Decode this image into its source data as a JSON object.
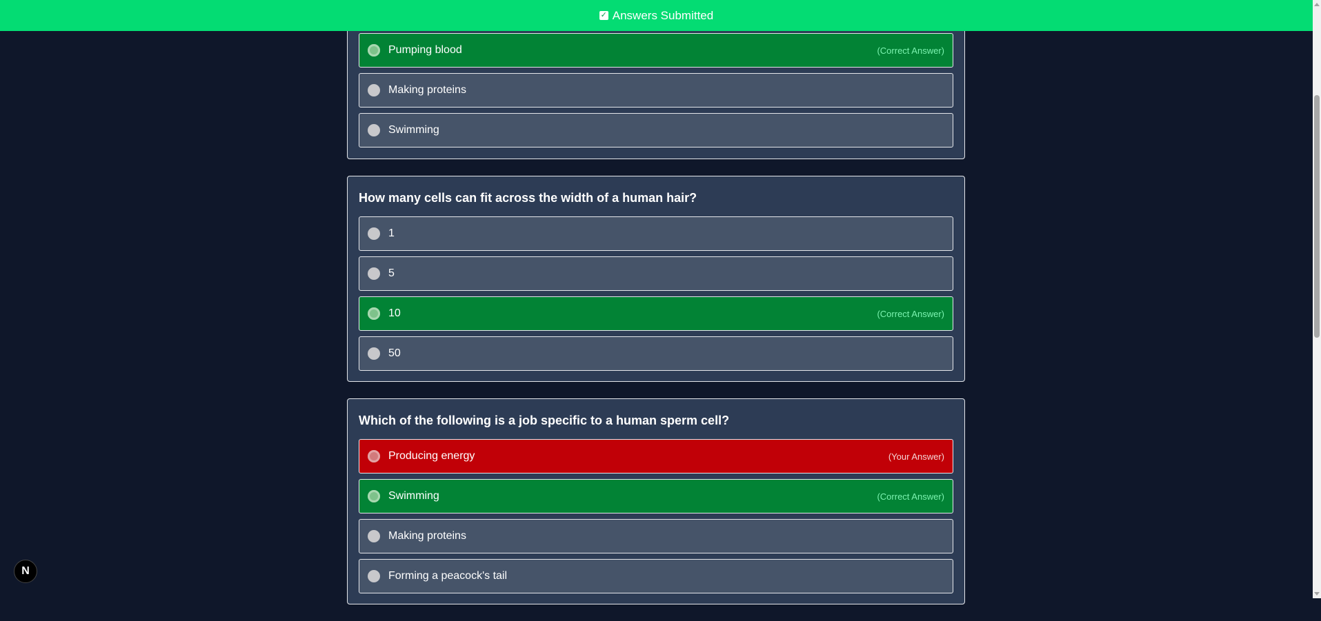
{
  "banner": {
    "check_icon": "check-square-icon",
    "text": "Answers Submitted",
    "color": "#04dc73"
  },
  "questions": [
    {
      "question": "",
      "options": [
        {
          "label": "Pumping blood",
          "status": "correct",
          "tag": "(Correct Answer)"
        },
        {
          "label": "Making proteins",
          "status": "none",
          "tag": ""
        },
        {
          "label": "Swimming",
          "status": "none",
          "tag": ""
        }
      ]
    },
    {
      "question": "How many cells can fit across the width of a human hair?",
      "options": [
        {
          "label": "1",
          "status": "none",
          "tag": ""
        },
        {
          "label": "5",
          "status": "none",
          "tag": ""
        },
        {
          "label": "10",
          "status": "correct",
          "tag": "(Correct Answer)"
        },
        {
          "label": "50",
          "status": "none",
          "tag": ""
        }
      ]
    },
    {
      "question": "Which of the following is a job specific to a human sperm cell?",
      "options": [
        {
          "label": "Producing energy",
          "status": "wrong",
          "tag": "(Your Answer)"
        },
        {
          "label": "Swimming",
          "status": "correct",
          "tag": "(Correct Answer)"
        },
        {
          "label": "Making proteins",
          "status": "none",
          "tag": ""
        },
        {
          "label": "Forming a peacock's tail",
          "status": "none",
          "tag": ""
        }
      ]
    }
  ],
  "colors": {
    "background": "#0f172a",
    "card": "#2d3c55",
    "option": "#465469",
    "correct": "#028335",
    "wrong": "#c10007"
  },
  "next_badge": {
    "letter": "N",
    "icon": "nextjs-logo-icon"
  }
}
